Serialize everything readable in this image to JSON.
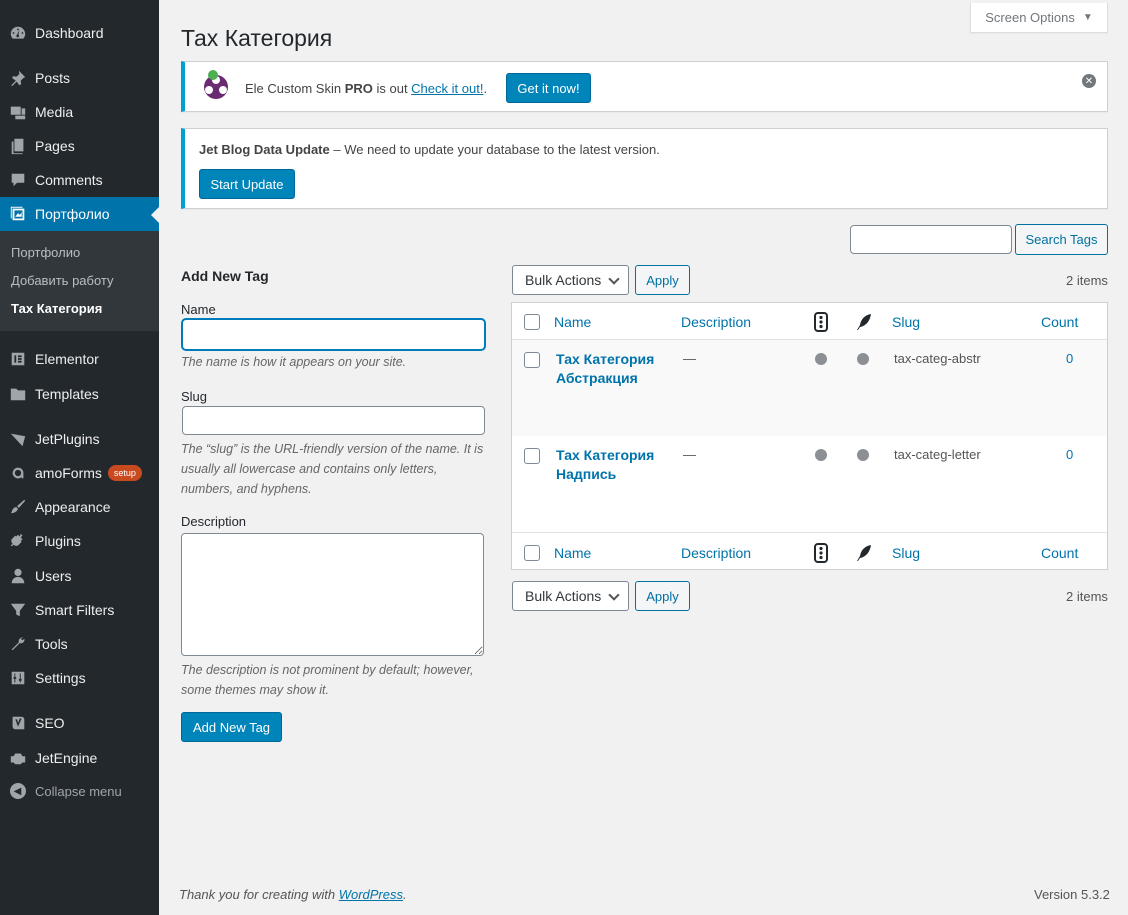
{
  "sidebar": {
    "items": [
      {
        "label": "Dashboard",
        "icon": "dashboard-icon"
      },
      {
        "label": "Posts",
        "icon": "pin-icon"
      },
      {
        "label": "Media",
        "icon": "media-icon"
      },
      {
        "label": "Pages",
        "icon": "pages-icon"
      },
      {
        "label": "Comments",
        "icon": "comment-icon"
      },
      {
        "label": "Портфолио",
        "icon": "portfolio-icon"
      },
      {
        "label": "Elementor",
        "icon": "elementor-icon"
      },
      {
        "label": "Templates",
        "icon": "folder-icon"
      },
      {
        "label": "JetPlugins",
        "icon": "jetplugins-icon"
      },
      {
        "label": "amoForms",
        "icon": "amoforms-icon",
        "badge": "setup"
      },
      {
        "label": "Appearance",
        "icon": "brush-icon"
      },
      {
        "label": "Plugins",
        "icon": "plug-icon"
      },
      {
        "label": "Users",
        "icon": "user-icon"
      },
      {
        "label": "Smart Filters",
        "icon": "filter-icon"
      },
      {
        "label": "Tools",
        "icon": "wrench-icon"
      },
      {
        "label": "Settings",
        "icon": "settings-icon"
      },
      {
        "label": "SEO",
        "icon": "yoast-icon"
      },
      {
        "label": "JetEngine",
        "icon": "jetengine-icon"
      }
    ],
    "submenu": [
      "Портфолио",
      "Добавить работу",
      "Тах Категория"
    ],
    "collapse": "Collapse menu"
  },
  "screen_options": "Screen Options",
  "page_title": "Тах Категория",
  "notice1": {
    "text_pre": "Ele Custom Skin ",
    "text_bold": "PRO",
    "text_mid": " is out ",
    "link": "Check it out!",
    "text_post": ".",
    "button": "Get it now!"
  },
  "notice2": {
    "bold": "Jet Blog Data Update",
    "text": " – We need to update your database to the latest version.",
    "button": "Start Update"
  },
  "search": {
    "button": "Search Tags",
    "value": ""
  },
  "form": {
    "heading": "Add New Tag",
    "name_label": "Name",
    "name_help": "The name is how it appears on your site.",
    "slug_label": "Slug",
    "slug_help": "The “slug” is the URL-friendly version of the name. It is usually all lowercase and contains only letters, numbers, and hyphens.",
    "desc_label": "Description",
    "desc_help": "The description is not prominent by default; however, some themes may show it.",
    "submit": "Add New Tag"
  },
  "bulk": {
    "label": "Bulk Actions",
    "apply": "Apply",
    "count": "2 items"
  },
  "table": {
    "columns": [
      "Name",
      "Description",
      "Slug",
      "Count"
    ],
    "rows": [
      {
        "name": "Тах Категория Абстракция",
        "description": "—",
        "slug": "tax-categ-abstr",
        "count": "0"
      },
      {
        "name": "Тах Категория Надпись",
        "description": "—",
        "slug": "tax-categ-letter",
        "count": "0"
      }
    ]
  },
  "footer": {
    "thanks_pre": "Thank you for creating with ",
    "thanks_link": "WordPress",
    "thanks_post": ".",
    "version": "Version 5.3.2"
  }
}
